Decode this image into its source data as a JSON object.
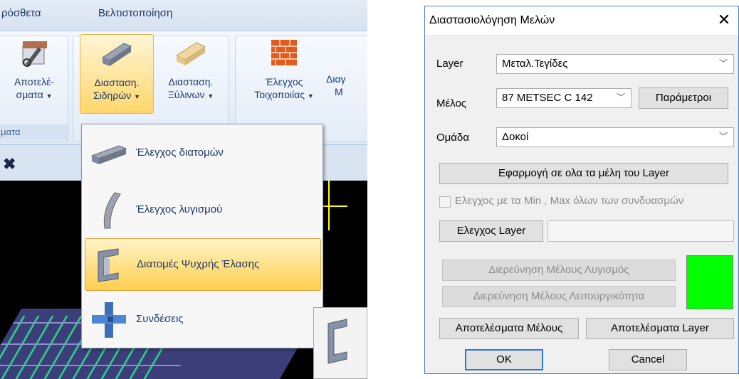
{
  "ribbon": {
    "tabs": [
      "ρόσθετα",
      "Βελτιστοποίηση"
    ],
    "group_label_left": "ματα",
    "buttons": [
      {
        "line1": "Αποτελέ-",
        "line2": "σματα"
      },
      {
        "line1": "Διασταση.",
        "line2": "Σιδηρών"
      },
      {
        "line1": "Διασταση.",
        "line2": "Ξύλινων"
      },
      {
        "line1": "Έλεγχος",
        "line2": "Τοιχοποιίας"
      },
      {
        "line1": "Διαγ",
        "line2": "Μ"
      }
    ],
    "close_glyph": "✖"
  },
  "dropdown": {
    "items": [
      {
        "label": "Έλεγχος διατομών",
        "icon": "i-beam-icon"
      },
      {
        "label": "Έλεγχος λυγισμού",
        "icon": "buckling-beam-icon"
      },
      {
        "label": "Διατομές Ψυχρής Έλασης",
        "icon": "cold-formed-section-icon"
      },
      {
        "label": "Συνδέσεις",
        "icon": "connection-icon"
      }
    ],
    "active_index": 2
  },
  "dialog": {
    "title": "Διαστασιολόγηση Μελών",
    "close_glyph": "✕",
    "layer_label": "Layer",
    "layer_value": "Μεταλ.Τεγίδες",
    "member_label": "Μέλος",
    "member_value": "87 METSEC C 142",
    "params_button": "Παράμετροι",
    "group_label": "Ομάδα",
    "group_value": "Δοκοί",
    "apply_all_button": "Εφαρμογή σε ολα τα μέλη του Layer",
    "minmax_checkbox": "Ελεγχος με τα Min , Max όλων των συνδυασμών",
    "check_layer_button": "Ελεγχος Layer",
    "check_layer_field": "",
    "investigate_buckling_button": "Διερεύνηση Μέλους Λυγισμός",
    "investigate_service_button": "Διερεύνηση Μέλους Λειτουργικότητα",
    "member_results_button": "Αποτελέσματα Μέλους",
    "layer_results_button": "Αποτελέσματα Layer",
    "ok_button": "OK",
    "cancel_button": "Cancel",
    "status_color": "#00ff00"
  },
  "colors": {
    "ribbon_hover": "#ffd66b",
    "dialog_accent": "#2b7ad6",
    "cad_background": "#000000"
  }
}
